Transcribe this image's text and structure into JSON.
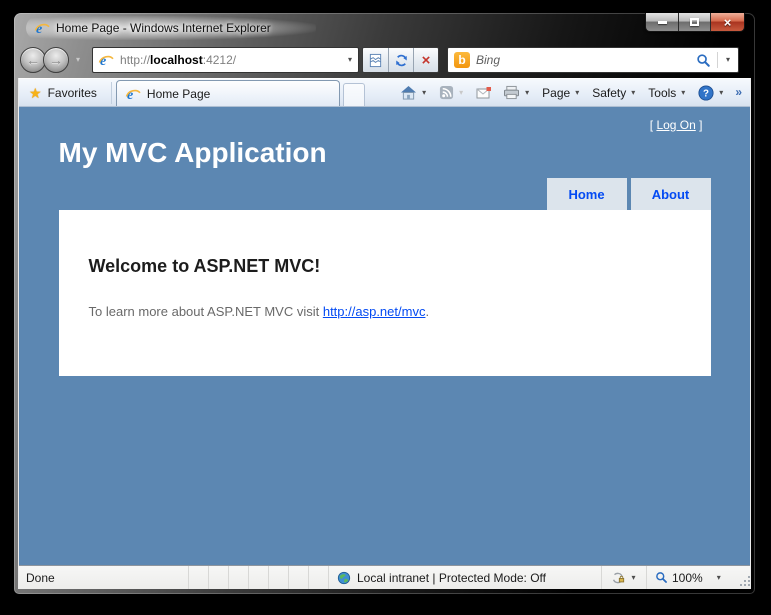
{
  "window": {
    "title": "Home Page - Windows Internet Explorer"
  },
  "navbar": {
    "url": {
      "scheme": "http://",
      "host": "localhost",
      "path": ":4212/"
    },
    "search": {
      "placeholder": "Bing"
    }
  },
  "tabbar": {
    "favorites_label": "Favorites",
    "active_tab_title": "Home Page",
    "command_bar": {
      "page_label": "Page",
      "safety_label": "Safety",
      "tools_label": "Tools"
    }
  },
  "page": {
    "logon": {
      "open_bracket": "[",
      "link_label": "Log On",
      "close_bracket": "]"
    },
    "app_title": "My MVC Application",
    "menu": [
      {
        "label": "Home"
      },
      {
        "label": "About"
      }
    ],
    "main": {
      "heading": "Welcome to ASP.NET MVC!",
      "paragraph_prefix": "To learn more about ASP.NET MVC visit ",
      "link_text": "http://asp.net/mvc",
      "paragraph_suffix": "."
    }
  },
  "statusbar": {
    "status": "Done",
    "zone": "Local intranet | Protected Mode: Off",
    "zoom": "100%"
  },
  "icons": {
    "star_glyph": "★",
    "dropdown_glyph": "▾",
    "back_glyph": "←",
    "forward_glyph": "→",
    "stop_glyph": "×",
    "close_glyph": "×",
    "more_glyph": "»",
    "bing_b_glyph": "b"
  },
  "colors": {
    "page_background": "#5c87b2",
    "menu_tab_background": "#dce4ec",
    "menu_tab_text": "#034af3",
    "link_blue": "#034af3",
    "body_text_gray": "#696969",
    "bing_orange": "#f2960f",
    "close_button_red": "#c85a3e"
  }
}
